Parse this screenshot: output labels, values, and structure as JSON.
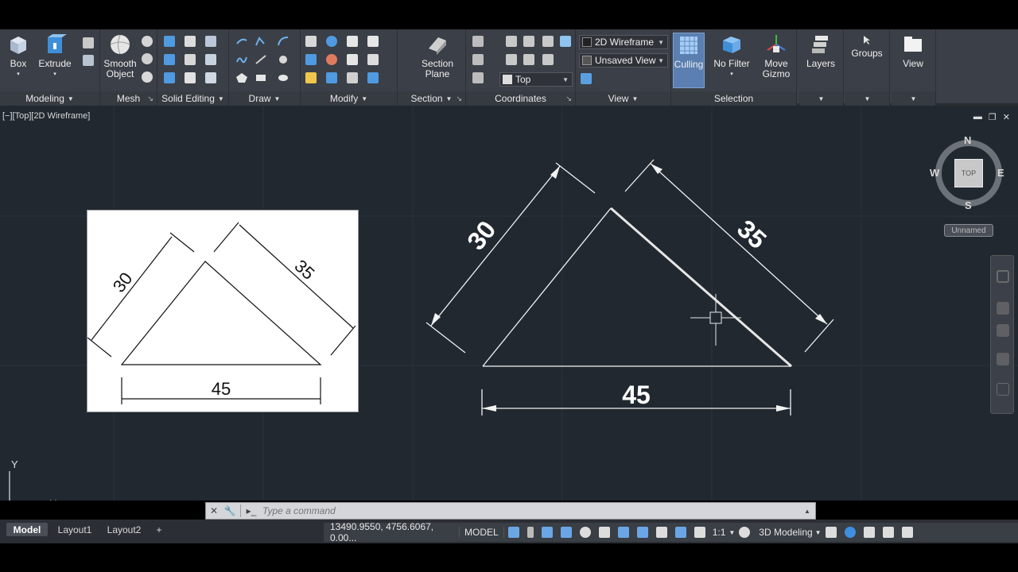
{
  "ribbon": {
    "modeling": {
      "box": "Box",
      "extrude": "Extrude",
      "title": "Modeling"
    },
    "mesh": {
      "smooth_line1": "Smooth",
      "smooth_line2": "Object",
      "title": "Mesh"
    },
    "solid_editing": {
      "title": "Solid Editing"
    },
    "draw": {
      "title": "Draw"
    },
    "modify": {
      "title": "Modify"
    },
    "section": {
      "btn_line1": "Section",
      "btn_line2": "Plane",
      "title": "Section"
    },
    "coordinates": {
      "title": "Coordinates"
    },
    "view": {
      "visual_style": "2D Wireframe",
      "saved_view": "Unsaved View",
      "view_dir": "Top",
      "title": "View"
    },
    "selection": {
      "culling": "Culling",
      "no_filter": "No Filter",
      "gizmo_line1": "Move",
      "gizmo_line2": "Gizmo",
      "title": "Selection"
    },
    "layers": "Layers",
    "groups": "Groups",
    "view_panel": "View"
  },
  "viewport": {
    "label": "[−][Top][2D Wireframe]",
    "reference_image": {
      "dim_left": "30",
      "dim_right": "35",
      "dim_bottom": "45"
    },
    "drawing": {
      "dim_left": "30",
      "dim_right": "35",
      "dim_bottom": "45"
    },
    "viewcube": {
      "n": "N",
      "s": "S",
      "e": "E",
      "w": "W",
      "face": "TOP"
    },
    "wcs_menu": "Unnamed",
    "ucs": {
      "x": "X",
      "y": "Y"
    }
  },
  "command": {
    "placeholder": "Type a command"
  },
  "tabs": [
    "Model",
    "Layout1",
    "Layout2",
    "+"
  ],
  "status": {
    "coordinates": "13490.9550, 4756.6067, 0.00...",
    "space": "MODEL",
    "scale": "1:1",
    "workspace": "3D Modeling"
  },
  "colors": {
    "ribbon_bg": "#3b3f47",
    "canvas_bg": "#212830",
    "accent": "#5a7fb0",
    "line": "#ffffff"
  }
}
